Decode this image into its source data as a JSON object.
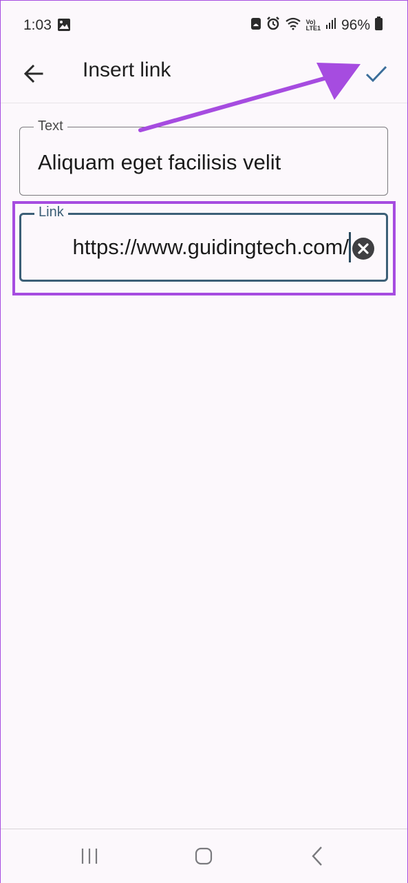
{
  "status_bar": {
    "time": "1:03",
    "network_label": "Vo)\nLTE1",
    "battery": "96%",
    "icons": [
      "image-icon",
      "android-icon",
      "alarm-icon",
      "wifi-icon",
      "volte-icon",
      "signal-icon",
      "battery-icon"
    ]
  },
  "app_bar": {
    "title": "Insert link",
    "back_icon": "arrow-left-icon",
    "confirm_icon": "check-icon"
  },
  "form": {
    "text_field": {
      "label": "Text",
      "value": "Aliquam eget facilisis velit"
    },
    "link_field": {
      "label": "Link",
      "value": "https://www.guidingtech.com/",
      "clear_icon": "clear-circle-icon"
    }
  },
  "annotation": {
    "color": "#a64ce0"
  },
  "nav_bar": {
    "icons": [
      "recents-icon",
      "home-icon",
      "back-icon"
    ]
  },
  "colors": {
    "accent": "#a64ce0",
    "field_focus": "#3c5f77",
    "check": "#3b6e9a",
    "background": "#fcf8fc"
  }
}
